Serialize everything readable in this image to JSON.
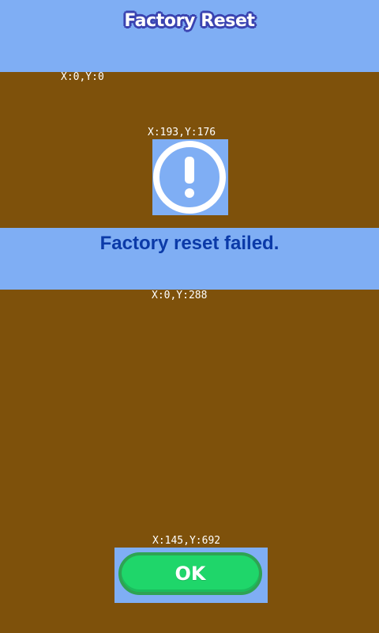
{
  "header": {
    "title": "Factory Reset"
  },
  "debug_labels": {
    "origin": "X:0,Y:0",
    "icon": "X:193,Y:176",
    "message": "X:0,Y:288",
    "button": "X:145,Y:692"
  },
  "dialog": {
    "icon": "exclamation-circle-icon",
    "message": "Factory reset failed.",
    "ok_label": "OK"
  },
  "colors": {
    "background": "#7e510b",
    "panel": "#7faef4",
    "title_outline": "#3a43b0",
    "message_text": "#0b3aa8",
    "ok_button": "#1fd66a",
    "ok_button_border": "#2ea353"
  }
}
